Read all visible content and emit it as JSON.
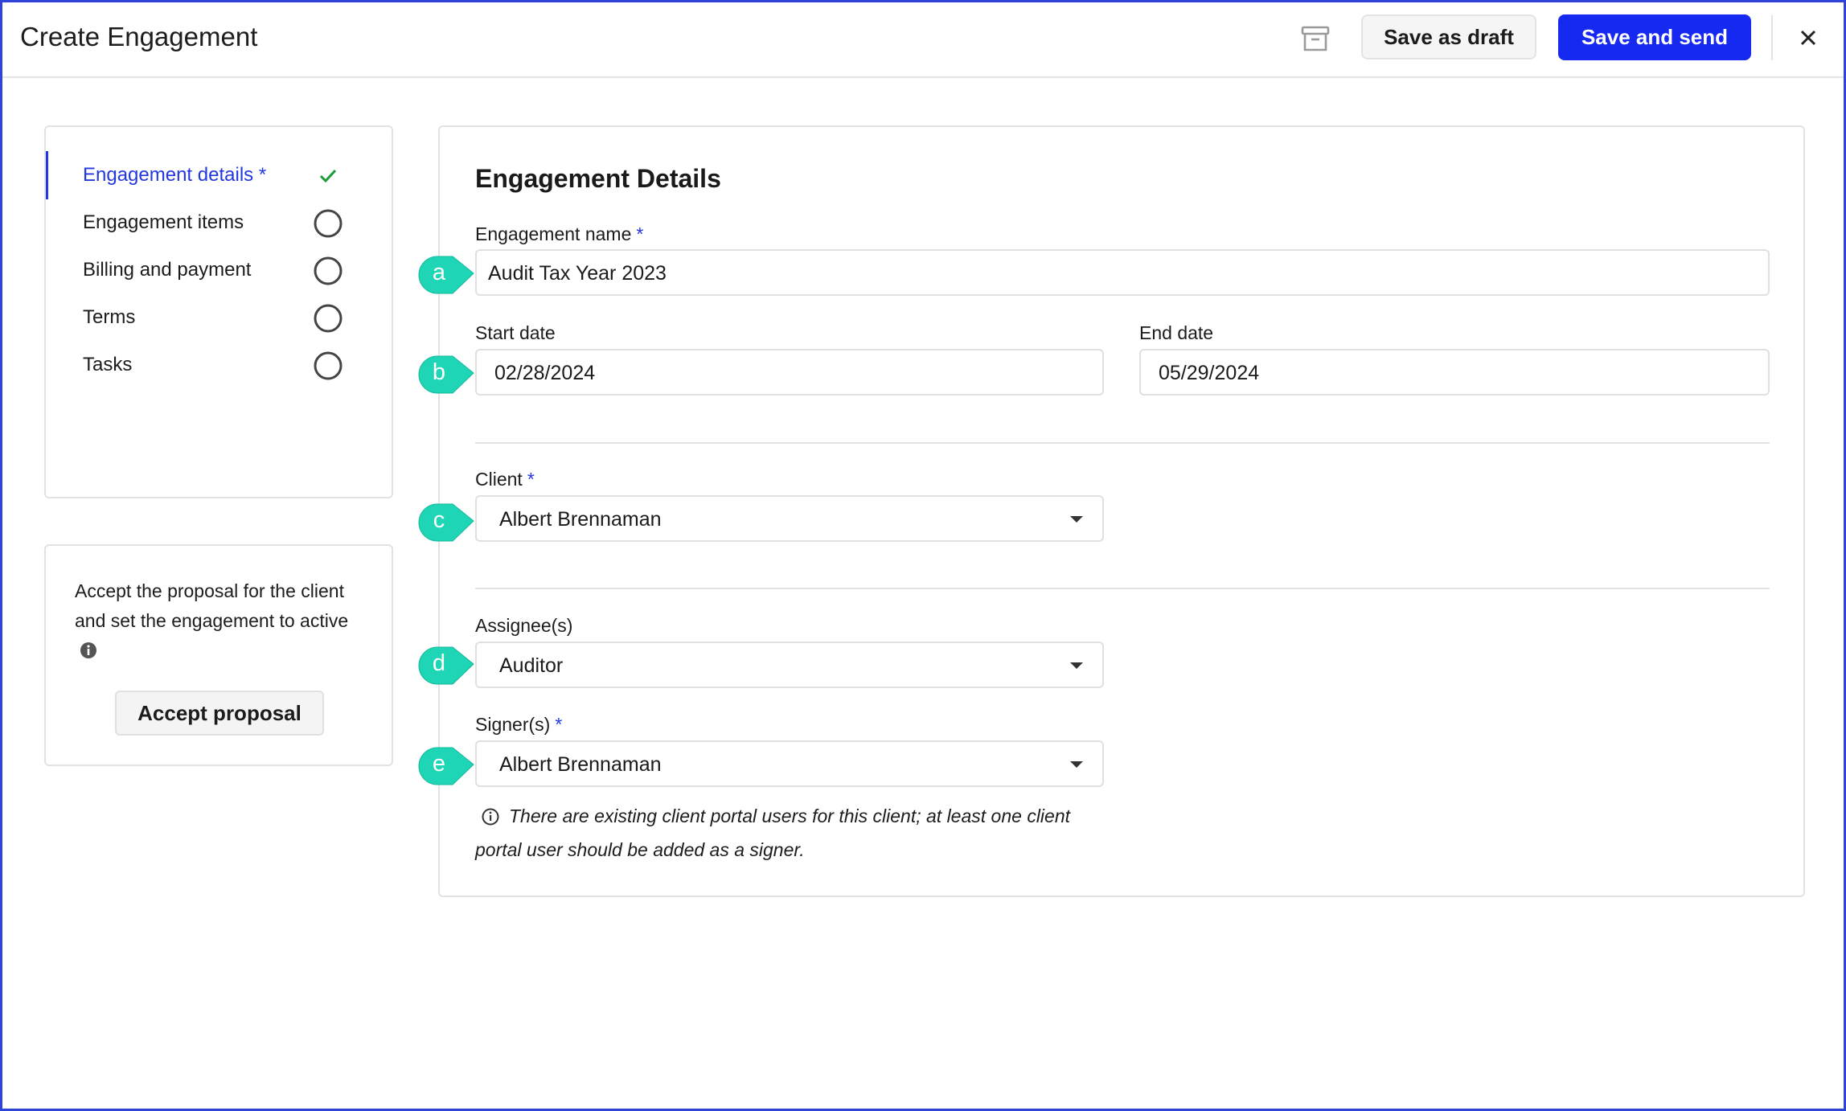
{
  "header": {
    "title": "Create Engagement",
    "archive_icon": "archive-icon",
    "save_draft_label": "Save as draft",
    "save_send_label": "Save and send",
    "close_icon": "close-icon"
  },
  "steps": [
    {
      "label": "Engagement details *",
      "status": "complete",
      "active": true
    },
    {
      "label": "Engagement items",
      "status": "incomplete",
      "active": false
    },
    {
      "label": "Billing and payment",
      "status": "incomplete",
      "active": false
    },
    {
      "label": "Terms",
      "status": "incomplete",
      "active": false
    },
    {
      "label": "Tasks",
      "status": "incomplete",
      "active": false
    }
  ],
  "accept": {
    "text": "Accept the proposal for the client and set the engagement to active",
    "button_label": "Accept proposal"
  },
  "form": {
    "title": "Engagement Details",
    "engagement_name": {
      "label": "Engagement name",
      "required": "*",
      "value": "Audit Tax Year 2023"
    },
    "start_date": {
      "label": "Start date",
      "value": "02/28/2024"
    },
    "end_date": {
      "label": "End date",
      "value": "05/29/2024"
    },
    "client": {
      "label": "Client",
      "required": "*",
      "value": "Albert Brennaman"
    },
    "assignees": {
      "label": "Assignee(s)",
      "value": "Auditor"
    },
    "signers": {
      "label": "Signer(s)",
      "required": "*",
      "value": "Albert Brennaman"
    },
    "signer_note": "There are existing client portal users for this client; at least one client portal user should be added as a signer."
  },
  "markers": [
    "a",
    "b",
    "c",
    "d",
    "e"
  ],
  "colors": {
    "accent": "#1629f0",
    "marker": "#1ed6b6",
    "check": "#1a9a3a"
  }
}
